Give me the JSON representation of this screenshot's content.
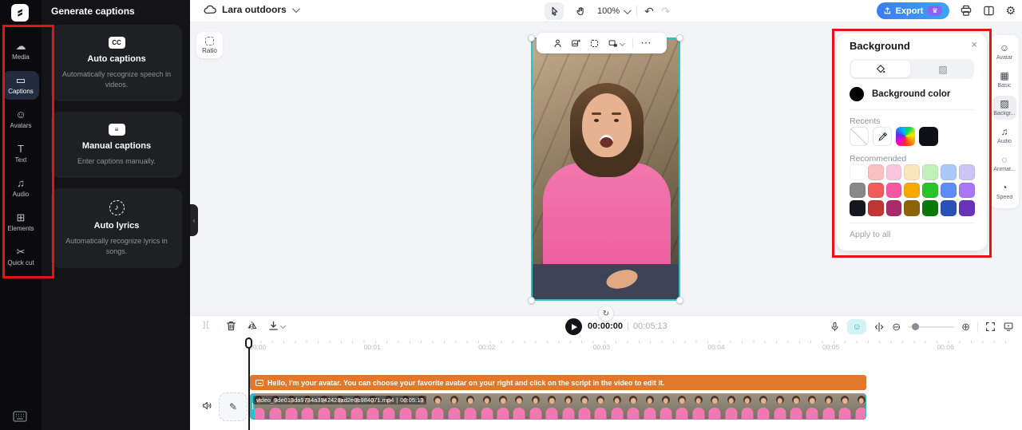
{
  "header": {
    "project_name": "Lara outdoors",
    "zoom_level": "100%",
    "export_label": "Export"
  },
  "left_rail": {
    "items": [
      {
        "label": "Media",
        "glyph": "☁",
        "active": false
      },
      {
        "label": "Captions",
        "glyph": "▭",
        "active": true
      },
      {
        "label": "Avatars",
        "glyph": "☺",
        "active": false
      },
      {
        "label": "Text",
        "glyph": "T",
        "active": false
      },
      {
        "label": "Audio",
        "glyph": "♫",
        "active": false
      },
      {
        "label": "Elements",
        "glyph": "⊞",
        "active": false
      },
      {
        "label": "Quick cut",
        "glyph": "✂",
        "active": false
      }
    ]
  },
  "captions_panel": {
    "title": "Generate captions",
    "cards": [
      {
        "icon": "cc",
        "glyph": "CC",
        "title": "Auto captions",
        "description": "Automatically recognize speech in videos."
      },
      {
        "icon": "lines",
        "glyph": "≡",
        "title": "Manual captions",
        "description": "Enter captions manually."
      },
      {
        "icon": "note",
        "glyph": "♪",
        "title": "Auto lyrics",
        "description": "Automatically recognize lyrics in songs."
      }
    ]
  },
  "canvas": {
    "ratio_label": "Ratio"
  },
  "background_panel": {
    "title": "Background",
    "color_label": "Background color",
    "current_color": "#000000",
    "recents_label": "Recents",
    "recommended_label": "Recommended",
    "apply_label": "Apply to all",
    "recent_black": "#0d1014",
    "recommended_colors": [
      "#ffffff",
      "#fbc0c1",
      "#fac6de",
      "#fae6bc",
      "#c2f0bb",
      "#aac9fa",
      "#cdc5f6",
      "#888888",
      "#f05c59",
      "#f757a0",
      "#f7a902",
      "#2ac328",
      "#5c8cf7",
      "#a877f7",
      "#15181e",
      "#c13532",
      "#aa2b69",
      "#8b6407",
      "#0a790a",
      "#2951b6",
      "#6933b9"
    ]
  },
  "right_rail": {
    "items": [
      {
        "label": "Avatar",
        "glyph": "☺",
        "active": false
      },
      {
        "label": "Basic",
        "glyph": "▦",
        "active": false
      },
      {
        "label": "Backgr...",
        "glyph": "▨",
        "active": true
      },
      {
        "label": "Audio",
        "glyph": "♫",
        "active": false
      },
      {
        "label": "Animat...",
        "glyph": "◌",
        "active": false
      },
      {
        "label": "Speed",
        "glyph": "◔",
        "active": false
      }
    ]
  },
  "timeline": {
    "current_time": "00:00:00",
    "separator": "|",
    "duration": "00:05:13",
    "ruler_labels": [
      "00:00",
      "00:01",
      "00:02",
      "00:03",
      "00:04",
      "00:05",
      "00:06"
    ],
    "caption": {
      "text": "Hello, I'm your avatar. You can choose your favorite avatar on your right and click on the script in the video to edit it."
    },
    "clip": {
      "filename": "video_9de013da9734a3942428ad2e0b984071.mp4",
      "separator": "|",
      "duration": "00:05:13",
      "thumb_count": 38
    }
  },
  "icons": {
    "undo": "↶",
    "redo": "↷",
    "gear": "⚙",
    "close": "×",
    "more": "⋯",
    "minus": "⊖",
    "plus": "⊕",
    "pencil": "✎",
    "crown": "♛",
    "split": "][",
    "pattern": "▨",
    "collapse": "‹",
    "rotate": "↻",
    "smart": "☺"
  }
}
